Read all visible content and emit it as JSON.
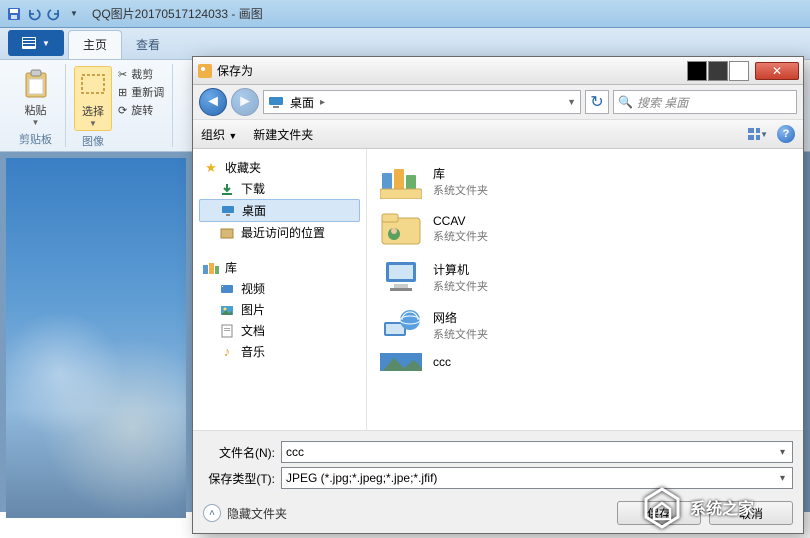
{
  "paint": {
    "title": "QQ图片20170517124033 - 画图",
    "tabs": {
      "home": "主页",
      "view": "查看"
    },
    "groups": {
      "clipboard": {
        "paste": "粘贴",
        "label": "剪贴板"
      },
      "image": {
        "select": "选择",
        "crop": "裁剪",
        "resize": "重新调",
        "rotate": "旋转",
        "label": "图像"
      }
    }
  },
  "dialog": {
    "title": "保存为",
    "nav": {
      "back": "◄",
      "fwd": "►"
    },
    "breadcrumb": "桌面",
    "search_placeholder": "搜索 桌面",
    "toolbar": {
      "organize": "组织",
      "new_folder": "新建文件夹"
    },
    "favorites": {
      "header": "收藏夹",
      "downloads": "下载",
      "desktop": "桌面",
      "recent": "最近访问的位置"
    },
    "libraries": {
      "header": "库",
      "videos": "视频",
      "pictures": "图片",
      "documents": "文档",
      "music": "音乐"
    },
    "items": [
      {
        "name": "库",
        "type": "系统文件夹",
        "icon": "libraries"
      },
      {
        "name": "CCAV",
        "type": "系统文件夹",
        "icon": "user"
      },
      {
        "name": "计算机",
        "type": "系统文件夹",
        "icon": "computer"
      },
      {
        "name": "网络",
        "type": "系统文件夹",
        "icon": "network"
      },
      {
        "name": "ccc",
        "type": "",
        "icon": "image"
      }
    ],
    "filename_label": "文件名(N):",
    "filename_value": "ccc",
    "filetype_label": "保存类型(T):",
    "filetype_value": "JPEG (*.jpg;*.jpeg;*.jpe;*.jfif)",
    "hide_folders": "隐藏文件夹",
    "save_btn": "保存",
    "cancel_btn": "取消"
  },
  "watermark": "系统之家"
}
